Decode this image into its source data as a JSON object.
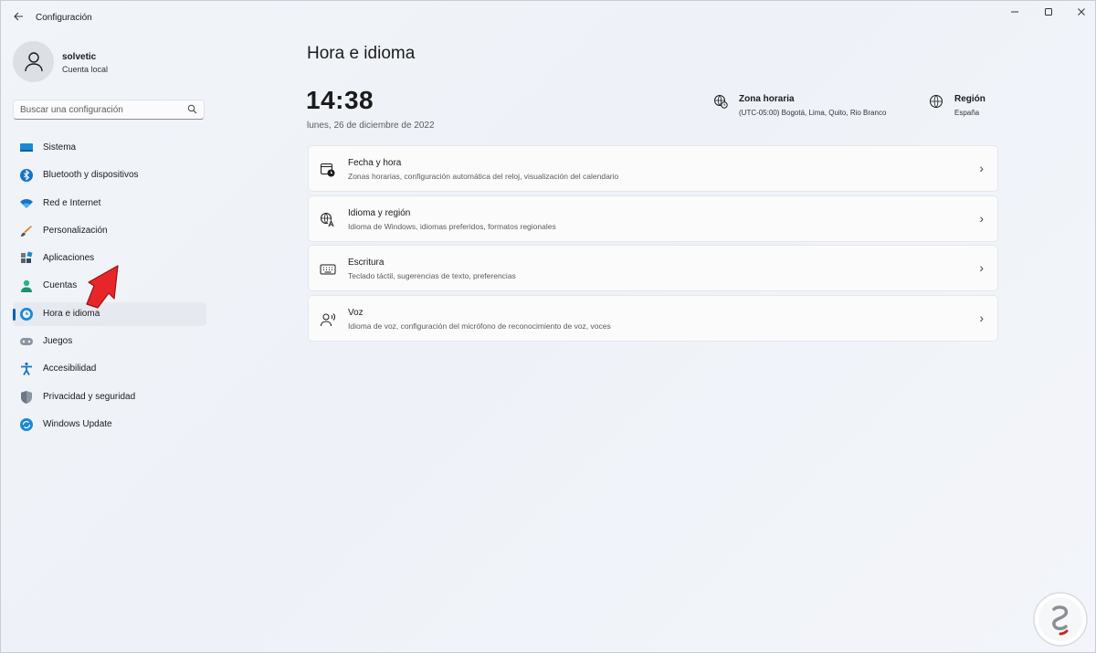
{
  "window": {
    "title": "Configuración",
    "controls": [
      "minimize-icon",
      "maximize-icon",
      "close-icon"
    ]
  },
  "profile": {
    "name": "solvetic",
    "account_type": "Cuenta local"
  },
  "search": {
    "placeholder": "Buscar una configuración"
  },
  "sidebar": {
    "items": [
      {
        "label": "Sistema",
        "icon": "monitor-icon"
      },
      {
        "label": "Bluetooth y dispositivos",
        "icon": "bluetooth-icon"
      },
      {
        "label": "Red e Internet",
        "icon": "wifi-icon"
      },
      {
        "label": "Personalización",
        "icon": "brush-icon"
      },
      {
        "label": "Aplicaciones",
        "icon": "apps-icon"
      },
      {
        "label": "Cuentas",
        "icon": "person-icon"
      },
      {
        "label": "Hora e idioma",
        "icon": "globe-clock-icon",
        "active": true
      },
      {
        "label": "Juegos",
        "icon": "gamepad-icon"
      },
      {
        "label": "Accesibilidad",
        "icon": "accessibility-icon"
      },
      {
        "label": "Privacidad y seguridad",
        "icon": "shield-icon"
      },
      {
        "label": "Windows Update",
        "icon": "update-icon"
      }
    ]
  },
  "main": {
    "title": "Hora e idioma",
    "time": "14:38",
    "date": "lunes, 26 de diciembre de 2022",
    "timezone": {
      "title": "Zona horaria",
      "value": "(UTC-05:00) Bogotá, Lima, Quito, Rio Branco"
    },
    "region": {
      "title": "Región",
      "value": "España"
    },
    "cards": [
      {
        "title": "Fecha y hora",
        "desc": "Zonas horarias, configuración automática del reloj, visualización del calendario",
        "icon": "calendar-clock-icon"
      },
      {
        "title": "Idioma y región",
        "desc": "Idioma de Windows, idiomas preferidos, formatos regionales",
        "icon": "language-icon"
      },
      {
        "title": "Escritura",
        "desc": "Teclado táctil, sugerencias de texto, preferencias",
        "icon": "keyboard-icon"
      },
      {
        "title": "Voz",
        "desc": "Idioma de voz, configuración del micrófono de reconocimiento de voz, voces",
        "icon": "speech-icon"
      }
    ]
  },
  "colors": {
    "accent": "#0a5fb4",
    "overlay_arrow": "#e8262a"
  }
}
